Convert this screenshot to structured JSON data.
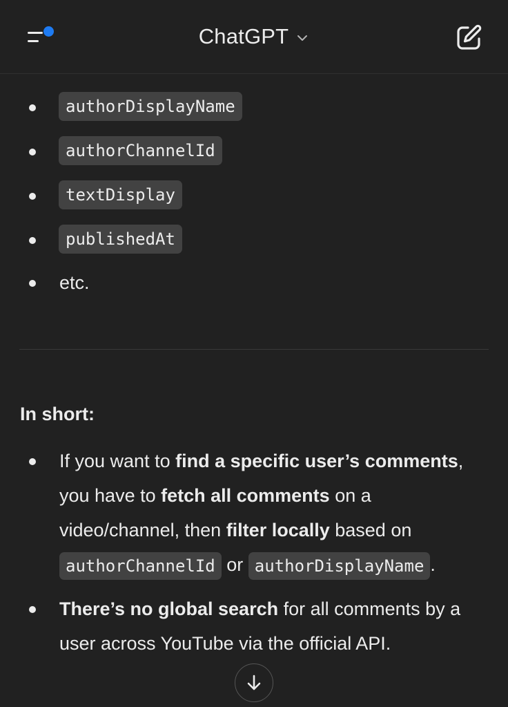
{
  "header": {
    "title": "ChatGPT",
    "menu_icon": "sidebar-menu-icon",
    "notification_color": "#1e7bf2",
    "chevron_icon": "chevron-down-icon",
    "compose_icon": "new-chat-icon"
  },
  "message": {
    "field_list": [
      {
        "code": "authorDisplayName"
      },
      {
        "code": "authorChannelId"
      },
      {
        "code": "textDisplay"
      },
      {
        "code": "publishedAt"
      }
    ],
    "etc_text": "etc.",
    "summary_heading": "In short:",
    "point1": {
      "t1": "If you want to ",
      "b1": "find a specific user’s comments",
      "t2": ", you have to ",
      "b2": "fetch all comments",
      "t3": " on a video/channel, then ",
      "b3": "filter locally",
      "t4": " based on ",
      "c1": "authorChannelId",
      "t5": " or ",
      "c2": "authorDisplayName",
      "t6": "."
    },
    "point2": {
      "b1": "There’s no global search",
      "t1": " for all comments by a user across YouTube via the official API."
    }
  },
  "scroll_button": {
    "icon": "arrow-down-icon"
  },
  "colors": {
    "background": "#212121",
    "code_background": "#424242",
    "text": "#ececec"
  }
}
